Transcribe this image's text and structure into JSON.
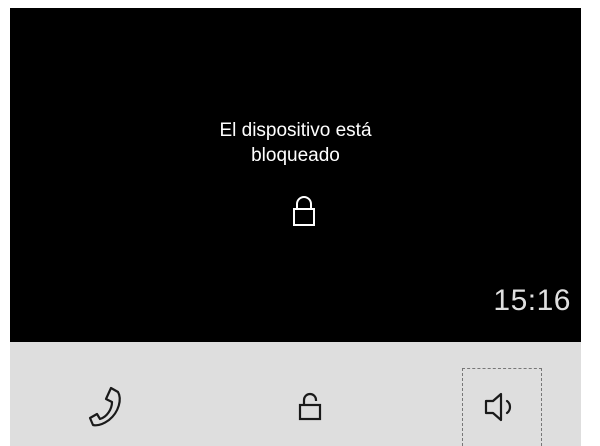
{
  "screen": {
    "message_line1": "El dispositivo está",
    "message_line2": "bloqueado",
    "lock_icon": "lock-closed-icon",
    "time": "15:16"
  },
  "toolbar": {
    "buttons": [
      {
        "icon": "phone-handset-icon"
      },
      {
        "icon": "lock-open-icon"
      },
      {
        "icon": "speaker-icon",
        "focused": true
      }
    ]
  },
  "colors": {
    "screen_bg": "#000000",
    "text": "#ffffff",
    "toolbar_bg": "#dedede"
  }
}
